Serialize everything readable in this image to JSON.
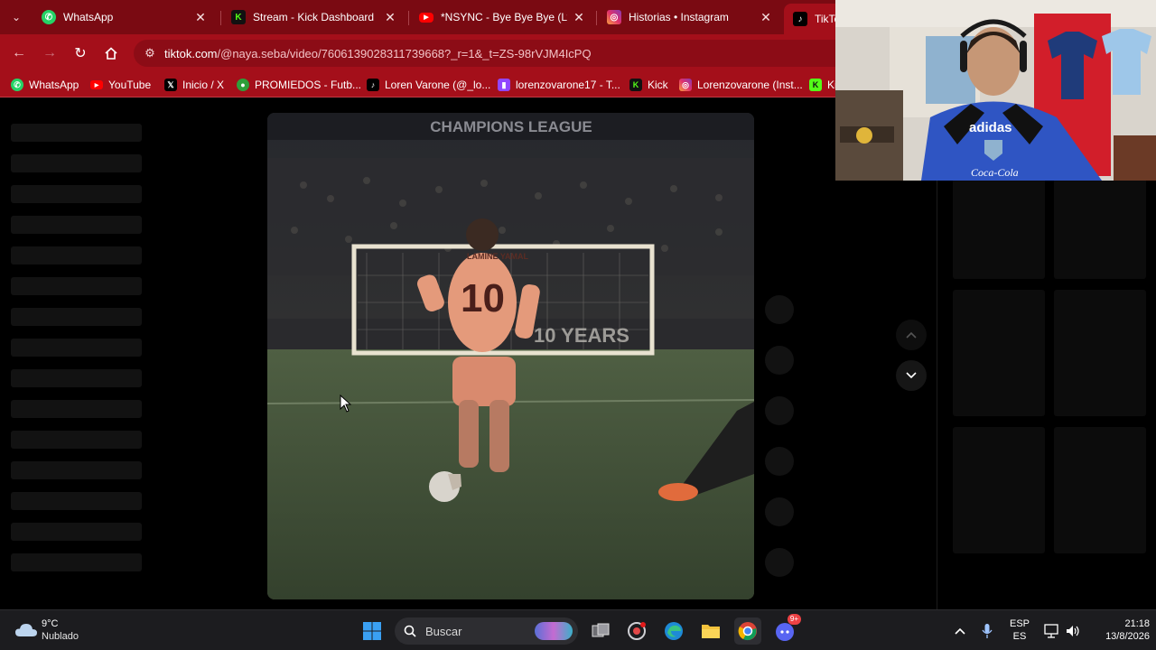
{
  "tabs": [
    {
      "title": "WhatsApp",
      "icon": "whatsapp-icon",
      "color": "#25d366"
    },
    {
      "title": "Stream - Kick Dashboard",
      "icon": "kick-icon",
      "color": "#53fc18"
    },
    {
      "title": "*NSYNC - Bye Bye Bye (Lyric",
      "icon": "youtube-icon",
      "color": "#ff0000"
    },
    {
      "title": "Historias • Instagram",
      "icon": "instagram-icon",
      "color": "#e1306c"
    },
    {
      "title": "TikTo",
      "icon": "tiktok-icon",
      "color": "#000000"
    }
  ],
  "address": {
    "domain": "tiktok.com",
    "path": "/@naya.seba/video/7606139028311739668?_r=1&_t=ZS-98rVJM4IcPQ"
  },
  "bookmarks": [
    {
      "label": "WhatsApp",
      "icon": "whatsapp-icon",
      "color": "#25d366"
    },
    {
      "label": "YouTube",
      "icon": "youtube-icon",
      "color": "#ff0000"
    },
    {
      "label": "Inicio / X",
      "icon": "x-icon",
      "color": "#000000"
    },
    {
      "label": "PROMIEDOS - Futb...",
      "icon": "promiedos-icon",
      "color": "#2e9e3a"
    },
    {
      "label": "Loren Varone (@_lo...",
      "icon": "tiktok-icon",
      "color": "#000000"
    },
    {
      "label": "lorenzovarone17 - T...",
      "icon": "twitch-icon",
      "color": "#9146ff"
    },
    {
      "label": "Kick",
      "icon": "kick-icon",
      "color": "#53fc18"
    },
    {
      "label": "Lorenzovarone (Inst...",
      "icon": "instagram-icon",
      "color": "#e1306c"
    },
    {
      "label": "Ki",
      "icon": "kick-icon",
      "color": "#53fc18"
    }
  ],
  "video": {
    "banner_text": "CHAMPIONS LEAGUE",
    "jersey_name": "LAMINE YAMAL",
    "jersey_number": "10",
    "board_text": "10 YEARS"
  },
  "cam": {
    "shirt_brand": "adidas",
    "sponsor": "Coca-Cola"
  },
  "taskbar": {
    "temperature": "9°C",
    "weather": "Nublado",
    "search_placeholder": "Buscar",
    "discord_badge": "9+",
    "lang_top": "ESP",
    "lang_bottom": "ES",
    "time": "21:18",
    "date": "13/8/2026"
  },
  "colors": {
    "browser_frame": "#7a0a12",
    "toolbar": "#a40f1a",
    "page_bg": "#000000"
  }
}
